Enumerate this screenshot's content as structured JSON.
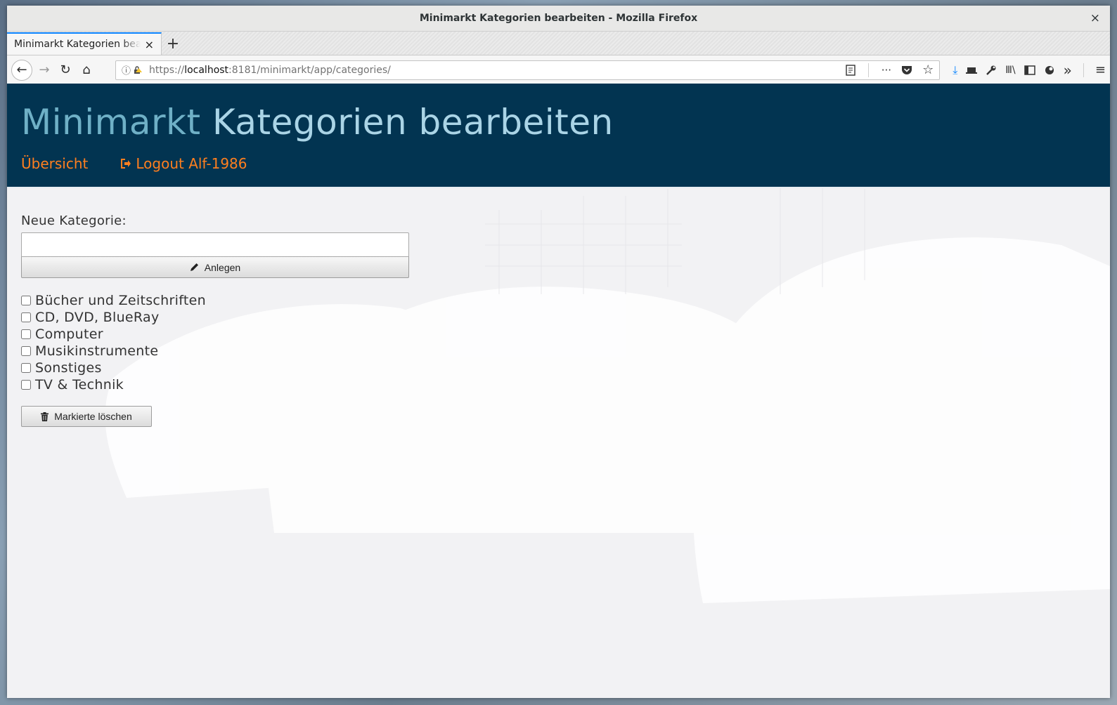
{
  "window": {
    "title": "Minimarkt Kategorien bearbeiten - Mozilla Firefox",
    "close_glyph": "×"
  },
  "tab": {
    "label": "Minimarkt Kategorien bearbeiten",
    "close_glyph": "×",
    "new_tab_glyph": "+"
  },
  "nav": {
    "back_glyph": "←",
    "forward_glyph": "→",
    "reload_glyph": "↻",
    "home_glyph": "⌂"
  },
  "url": {
    "scheme": "https://",
    "host": "localhost",
    "rest": ":8181/minimarkt/app/categories/",
    "info_glyph": "ⓘ"
  },
  "toolbar_icons": {
    "reader": "reader-view-icon",
    "more": "···",
    "pocket": "pocket-icon",
    "bookmark": "☆",
    "download": "⤓",
    "screenshot": "▬",
    "tools": "wrench-icon",
    "library": "Ⅲ\\",
    "sidebar": "sidebar-icon",
    "extension": "extension-icon",
    "overflow": "»",
    "menu": "≡"
  },
  "header": {
    "brand": "Minimarkt",
    "title": "Kategorien bearbeiten",
    "nav_overview": "Übersicht",
    "nav_logout": "Logout Alf-1986",
    "colors": {
      "background": "#023451",
      "link": "#ff7f1f"
    }
  },
  "form": {
    "new_category_label": "Neue Kategorie:",
    "new_category_value": "",
    "create_button": "Anlegen",
    "delete_button": "Markierte löschen"
  },
  "categories": [
    {
      "label": "Bücher und Zeitschriften",
      "checked": false
    },
    {
      "label": "CD, DVD, BlueRay",
      "checked": false
    },
    {
      "label": "Computer",
      "checked": false
    },
    {
      "label": "Musikinstrumente",
      "checked": false
    },
    {
      "label": "Sonstiges",
      "checked": false
    },
    {
      "label": "TV & Technik",
      "checked": false
    }
  ]
}
